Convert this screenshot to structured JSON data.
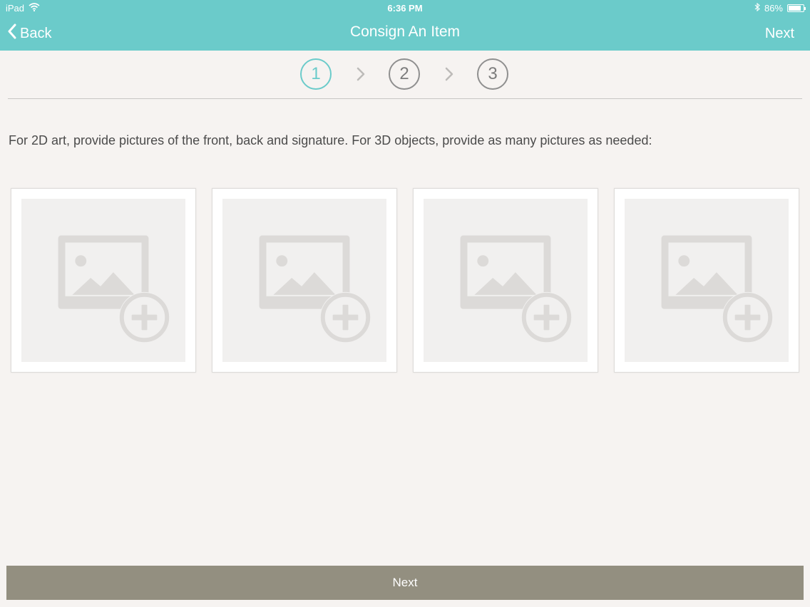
{
  "status_bar": {
    "device": "iPad",
    "time": "6:36 PM",
    "battery": "86%",
    "battery_level": 0.86
  },
  "nav": {
    "back_label": "Back",
    "title": "Consign An Item",
    "next_label": "Next"
  },
  "stepper": {
    "steps": [
      "1",
      "2",
      "3"
    ],
    "active_step": 1
  },
  "instructions": "For 2D art, provide pictures of the front, back and signature.  For 3D objects, provide as many pictures as needed:",
  "photos": {
    "slots": 4,
    "icon": "add-photo-icon"
  },
  "footer": {
    "next_label": "Next"
  },
  "colors": {
    "accent": "#6bcbca",
    "background": "#f6f3f1",
    "footer_button": "#938f80",
    "step_inactive": "#8f8f8f",
    "placeholder_icon": "#dcdad8"
  }
}
